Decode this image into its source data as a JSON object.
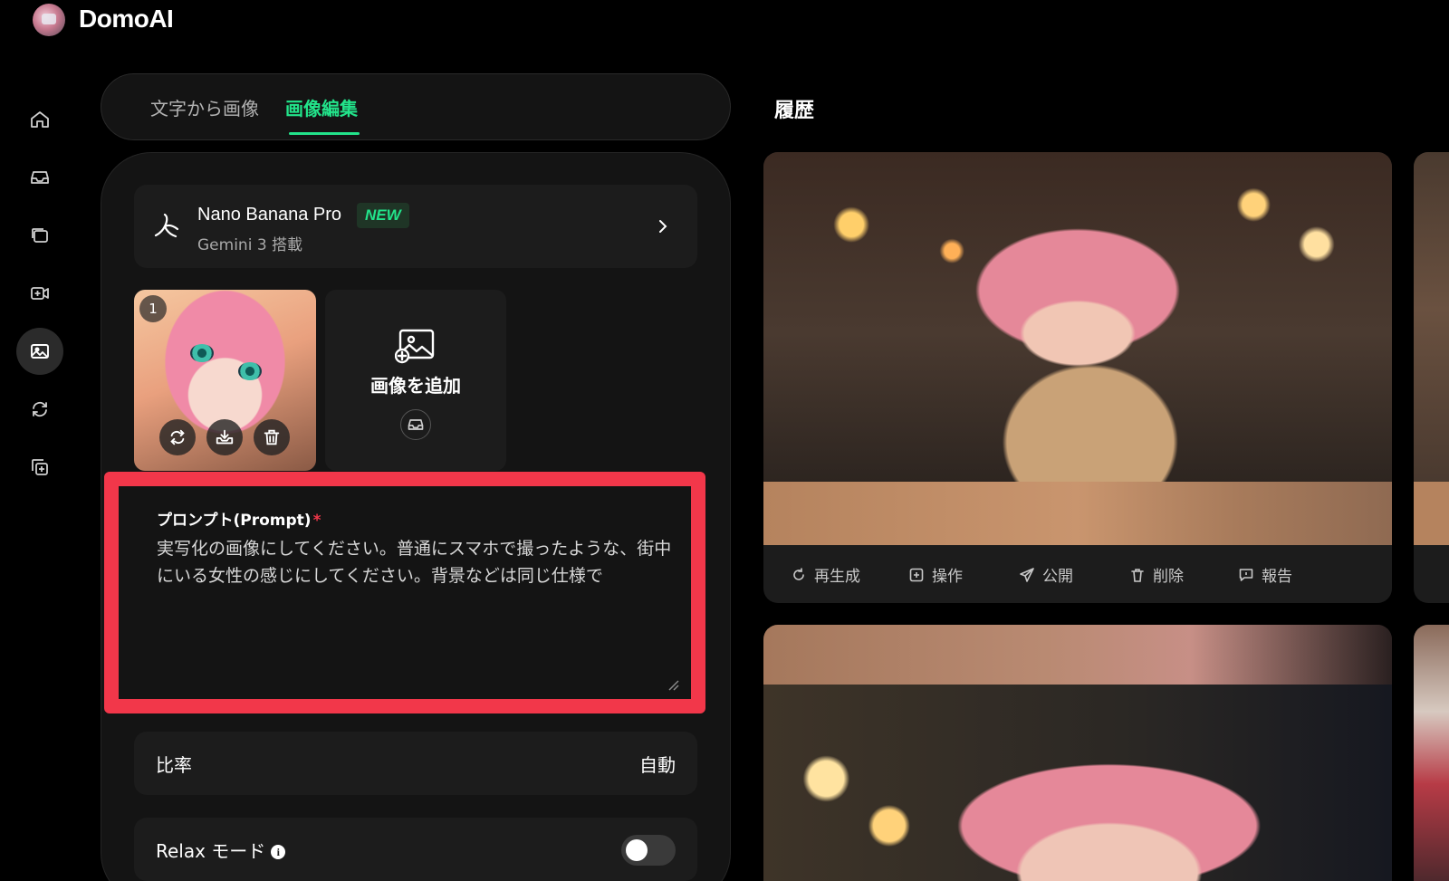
{
  "app": {
    "brand": "DomoAI"
  },
  "tabs": [
    {
      "label": "文字から画像"
    },
    {
      "label": "画像編集"
    }
  ],
  "model": {
    "name": "Nano Banana Pro",
    "badge": "NEW",
    "subtitle": "Gemini 3 搭載"
  },
  "uploads": {
    "first_index": "1",
    "add_label": "画像を追加"
  },
  "prompt": {
    "label": "プロンプト(Prompt)",
    "required_mark": "*",
    "value": "実写化の画像にしてください。普通にスマホで撮ったような、街中にいる女性の感じにしてください。背景などは同じ仕様で"
  },
  "settings": {
    "ratio_label": "比率",
    "ratio_value": "自動",
    "relax_label": "Relax モード",
    "relax_enabled": false
  },
  "history": {
    "title": "履歴",
    "actions": [
      "再生成",
      "操作",
      "公開",
      "削除",
      "報告"
    ]
  },
  "colors": {
    "accent": "#22e38a",
    "highlight": "#f2374a",
    "panel": "#141414",
    "card": "#1c1c1c"
  }
}
